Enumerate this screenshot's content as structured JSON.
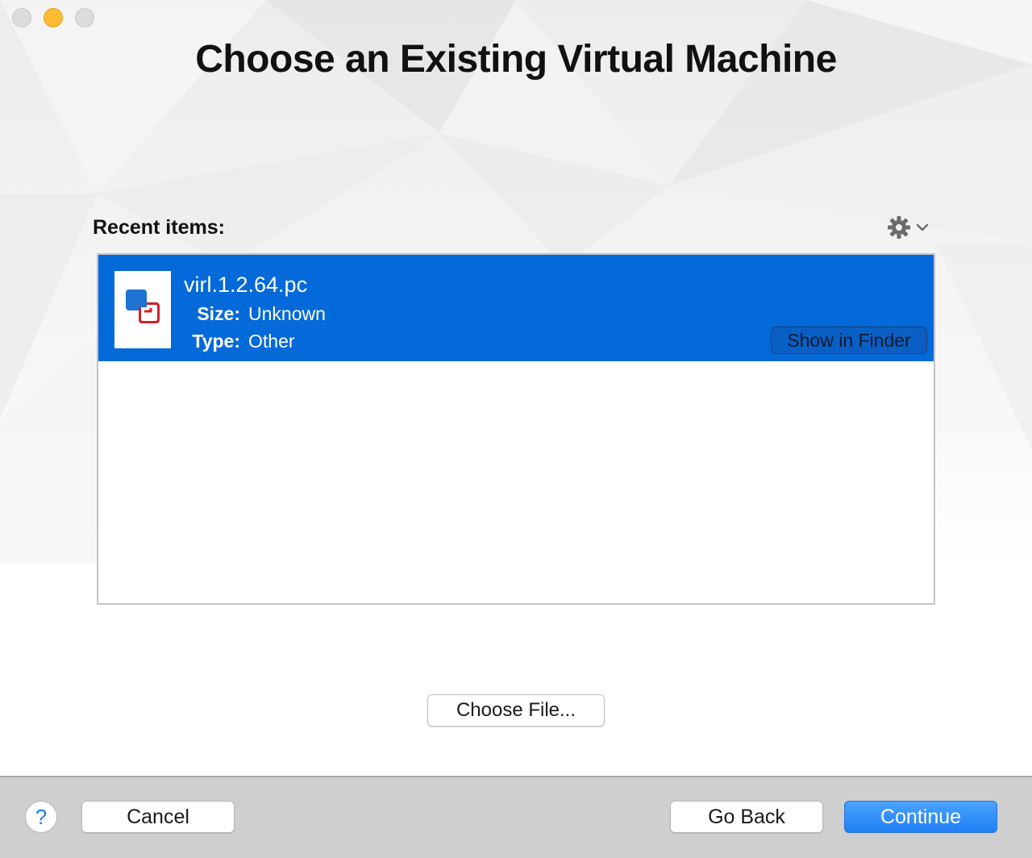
{
  "window": {
    "title": "Choose an Existing Virtual Machine"
  },
  "recent": {
    "label": "Recent items:",
    "gear_icon": "gear-icon",
    "items": [
      {
        "name": "virl.1.2.64.pc",
        "size_label": "Size:",
        "size_value": "Unknown",
        "type_label": "Type:",
        "type_value": "Other",
        "show_in_finder": "Show in Finder",
        "icon": "vmware-fusion-icon",
        "selected": true
      }
    ]
  },
  "actions": {
    "choose_file": "Choose File..."
  },
  "footer": {
    "help": "?",
    "cancel": "Cancel",
    "go_back": "Go Back",
    "continue": "Continue"
  },
  "colors": {
    "selection": "#0469d9",
    "primary_button": "#1f7ff5",
    "footer_bg": "#cfcfcf"
  }
}
